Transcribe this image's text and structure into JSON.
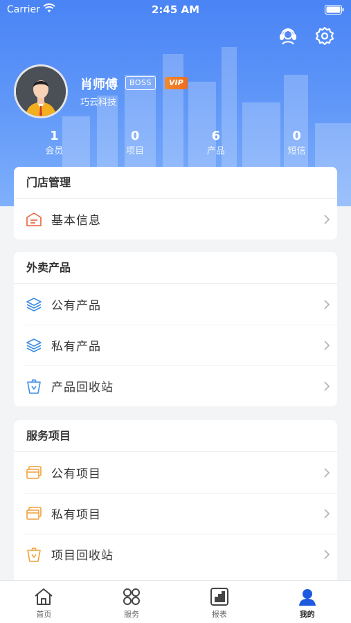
{
  "status_bar": {
    "carrier": "Carrier",
    "time": "2:45 AM"
  },
  "header": {
    "support_icon": "headset-icon",
    "settings_icon": "gear-icon"
  },
  "profile": {
    "name": "肖师傅",
    "role_badge": "BOSS",
    "vip_badge": "VIP",
    "company": "巧云科技"
  },
  "stats": [
    {
      "value": "1",
      "label": "会员"
    },
    {
      "value": "0",
      "label": "项目"
    },
    {
      "value": "6",
      "label": "产品"
    },
    {
      "value": "0",
      "label": "短信"
    }
  ],
  "sections": {
    "store": {
      "title": "门店管理",
      "items": [
        {
          "label": "基本信息",
          "icon": "id-card-icon"
        }
      ]
    },
    "products": {
      "title": "外卖产品",
      "items": [
        {
          "label": "公有产品",
          "icon": "layers-icon"
        },
        {
          "label": "私有产品",
          "icon": "layers-icon"
        },
        {
          "label": "产品回收站",
          "icon": "recycle-bin-icon"
        }
      ]
    },
    "services": {
      "title": "服务项目",
      "items": [
        {
          "label": "公有项目",
          "icon": "cards-icon"
        },
        {
          "label": "私有项目",
          "icon": "cards-icon"
        },
        {
          "label": "项目回收站",
          "icon": "recycle-bin-icon"
        }
      ]
    }
  },
  "tabbar": [
    {
      "label": "首页",
      "icon": "home-icon",
      "active": false
    },
    {
      "label": "服务",
      "icon": "grid-icon",
      "active": false
    },
    {
      "label": "报表",
      "icon": "chart-icon",
      "active": false
    },
    {
      "label": "我的",
      "icon": "user-icon",
      "active": true
    }
  ],
  "colors": {
    "brand_blue": "#4a84f5",
    "vip_orange": "#ef6b1e",
    "store_icon": "#e8623a",
    "product_icon": "#3a8ee6",
    "service_icon": "#f0a13a"
  }
}
